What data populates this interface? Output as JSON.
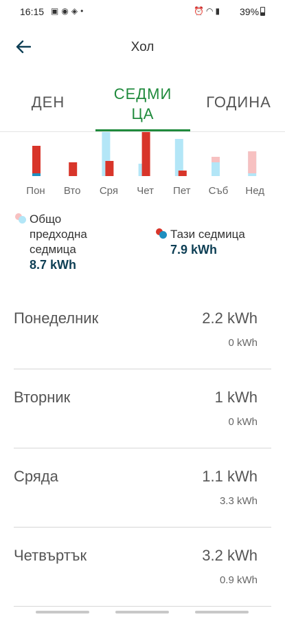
{
  "status_bar": {
    "time": "16:15",
    "left_icons": [
      "gallery-icon",
      "messenger-icon",
      "navigation-icon",
      "dot-icon"
    ],
    "right_icons": [
      "alarm-icon",
      "wifi-icon",
      "signal-icon"
    ],
    "battery": "39%"
  },
  "app_bar": {
    "title": "Хол"
  },
  "tabs": [
    {
      "label": "ДЕН",
      "selected": false
    },
    {
      "label": "СЕДМИЦА",
      "line1": "СЕДМИ",
      "line2": "ЦА",
      "selected": true
    },
    {
      "label": "ГОДИНА",
      "selected": false
    }
  ],
  "colors": {
    "accent": "#1f8a3c",
    "current_week": "#d8352a",
    "current_week_secondary": "#1f8fc0",
    "previous_week": "#b3e6f7",
    "previous_week_secondary": "#f7c1c1",
    "value_text": "#0e3f55"
  },
  "chart_data": {
    "type": "bar",
    "categories": [
      "Пон",
      "Вто",
      "Сря",
      "Чет",
      "Пет",
      "Съб",
      "Нед"
    ],
    "series": [
      {
        "name": "Общо предходна седмица",
        "values": [
          0,
          0,
          3.3,
          0.9,
          2.7,
          1.4,
          1.8
        ]
      },
      {
        "name": "Тази седмица",
        "values": [
          2.2,
          1,
          1.1,
          3.2,
          0.4,
          0,
          0
        ]
      }
    ],
    "secondary_fill": {
      "Общо предходна седмица": [
        0,
        0,
        0,
        0,
        0,
        0.4,
        1.6
      ],
      "Тази седмица": [
        0.2,
        0,
        0,
        0,
        0,
        0,
        0
      ]
    }
  },
  "legend": {
    "previous": {
      "line1": "Общо",
      "line2": "предходна",
      "line3": "седмица",
      "value": "8.7 kWh"
    },
    "current": {
      "label": "Тази седмица",
      "value": "7.9 kWh"
    }
  },
  "rows": [
    {
      "day": "Понеделник",
      "current": "2.2 kWh",
      "previous": "0 kWh"
    },
    {
      "day": "Вторник",
      "current": "1 kWh",
      "previous": "0 kWh"
    },
    {
      "day": "Сряда",
      "current": "1.1 kWh",
      "previous": "3.3 kWh"
    },
    {
      "day": "Четвъртък",
      "current": "3.2 kWh",
      "previous": "0.9 kWh"
    }
  ]
}
